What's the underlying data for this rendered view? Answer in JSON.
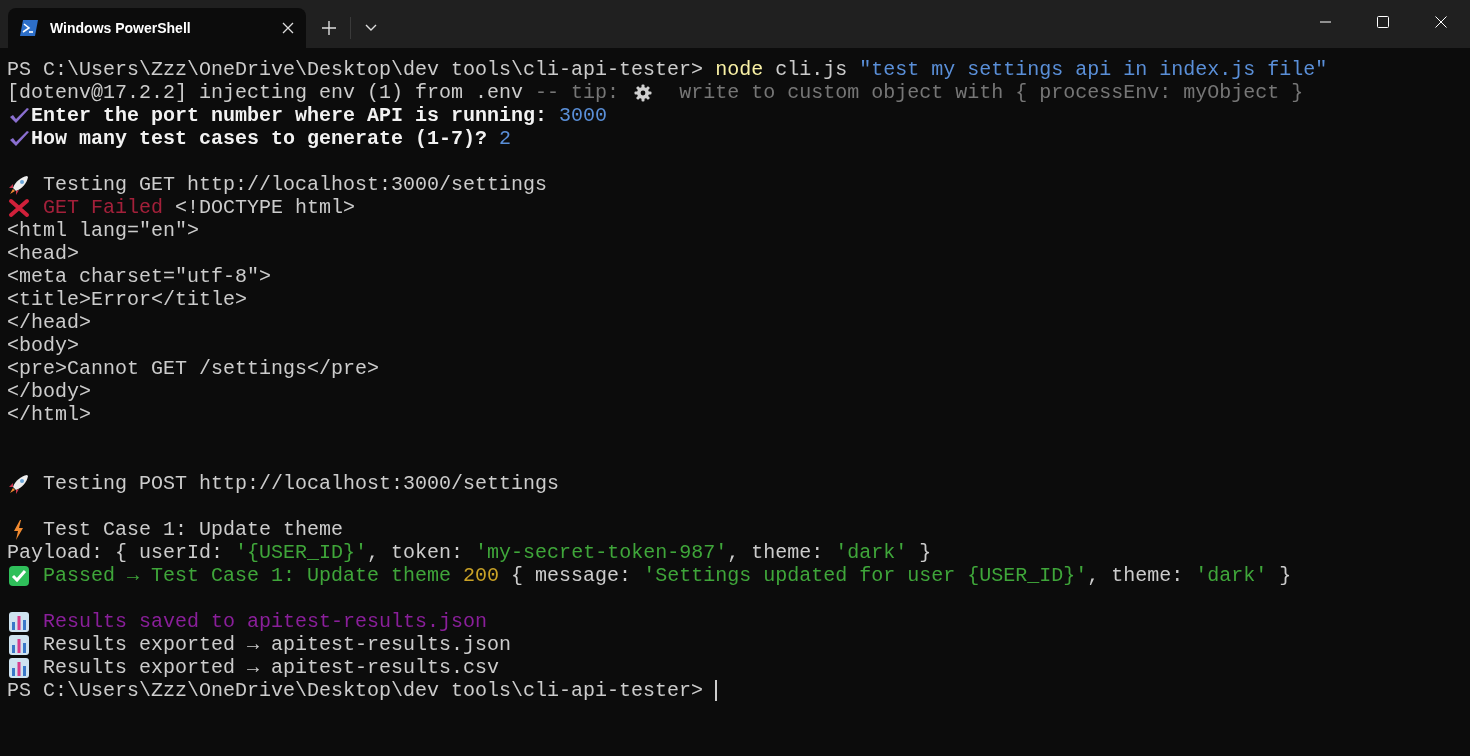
{
  "window": {
    "tab_title": "Windows PowerShell"
  },
  "terminal": {
    "lines": [
      {
        "kind": "text",
        "segments": [
          {
            "kind": "plain",
            "text": "PS C:\\Users\\Zzz\\OneDrive\\Desktop\\dev tools\\cli-api-tester> "
          },
          {
            "kind": "command",
            "text": "node"
          },
          {
            "kind": "plain",
            "text": " cli.js "
          },
          {
            "kind": "string",
            "text": "\"test my settings api in index.js file\""
          }
        ]
      },
      {
        "kind": "text",
        "segments": [
          {
            "kind": "plain",
            "text": "[dotenv@17.2.2] injecting env (1) from .env"
          },
          {
            "kind": "hint",
            "text": " -- tip: "
          },
          {
            "kind": "gear"
          },
          {
            "kind": "hint",
            "text": "  write to custom object with { processEnv: myObject }"
          }
        ]
      },
      {
        "kind": "text",
        "segments": [
          {
            "kind": "tick"
          },
          {
            "kind": "question",
            "text": "Enter the port number where API is running: "
          },
          {
            "kind": "answer",
            "text": "3000"
          }
        ]
      },
      {
        "kind": "text",
        "segments": [
          {
            "kind": "tick"
          },
          {
            "kind": "question",
            "text": "How many test cases to generate (1-7)? "
          },
          {
            "kind": "answer",
            "text": "2"
          }
        ]
      },
      {
        "kind": "blank"
      },
      {
        "kind": "text",
        "segments": [
          {
            "kind": "rocket"
          },
          {
            "kind": "plain",
            "text": " Testing GET http://localhost:3000/settings"
          }
        ]
      },
      {
        "kind": "text",
        "segments": [
          {
            "kind": "cross"
          },
          {
            "kind": "error",
            "text": " GET Failed"
          },
          {
            "kind": "plain",
            "text": " <!DOCTYPE html>"
          }
        ]
      },
      {
        "kind": "text",
        "segments": [
          {
            "kind": "plain",
            "text": "<html lang=\"en\">"
          }
        ]
      },
      {
        "kind": "text",
        "segments": [
          {
            "kind": "plain",
            "text": "<head>"
          }
        ]
      },
      {
        "kind": "text",
        "segments": [
          {
            "kind": "plain",
            "text": "<meta charset=\"utf-8\">"
          }
        ]
      },
      {
        "kind": "text",
        "segments": [
          {
            "kind": "plain",
            "text": "<title>Error</title>"
          }
        ]
      },
      {
        "kind": "text",
        "segments": [
          {
            "kind": "plain",
            "text": "</head>"
          }
        ]
      },
      {
        "kind": "text",
        "segments": [
          {
            "kind": "plain",
            "text": "<body>"
          }
        ]
      },
      {
        "kind": "text",
        "segments": [
          {
            "kind": "plain",
            "text": "<pre>Cannot GET /settings</pre>"
          }
        ]
      },
      {
        "kind": "text",
        "segments": [
          {
            "kind": "plain",
            "text": "</body>"
          }
        ]
      },
      {
        "kind": "text",
        "segments": [
          {
            "kind": "plain",
            "text": "</html>"
          }
        ]
      },
      {
        "kind": "blank"
      },
      {
        "kind": "blank"
      },
      {
        "kind": "text",
        "segments": [
          {
            "kind": "rocket"
          },
          {
            "kind": "plain",
            "text": " Testing POST http://localhost:3000/settings"
          }
        ]
      },
      {
        "kind": "blank"
      },
      {
        "kind": "text",
        "segments": [
          {
            "kind": "bolt"
          },
          {
            "kind": "plain",
            "text": " Test Case 1: Update theme"
          }
        ]
      },
      {
        "kind": "text",
        "segments": [
          {
            "kind": "plain",
            "text": "Payload: { userId: "
          },
          {
            "kind": "value",
            "text": "'{USER_ID}'"
          },
          {
            "kind": "plain",
            "text": ", token: "
          },
          {
            "kind": "value",
            "text": "'my-secret-token-987'"
          },
          {
            "kind": "plain",
            "text": ", theme: "
          },
          {
            "kind": "value",
            "text": "'dark'"
          },
          {
            "kind": "plain",
            "text": " }"
          }
        ]
      },
      {
        "kind": "text",
        "segments": [
          {
            "kind": "checkbox"
          },
          {
            "kind": "value",
            "text": " Passed → Test Case 1: Update theme "
          },
          {
            "kind": "status",
            "text": "200"
          },
          {
            "kind": "plain",
            "text": " { message: "
          },
          {
            "kind": "value",
            "text": "'Settings updated for user {USER_ID}'"
          },
          {
            "kind": "plain",
            "text": ", theme: "
          },
          {
            "kind": "value",
            "text": "'dark'"
          },
          {
            "kind": "plain",
            "text": " }"
          }
        ]
      },
      {
        "kind": "blank"
      },
      {
        "kind": "text",
        "segments": [
          {
            "kind": "chart"
          },
          {
            "kind": "saved",
            "text": " Results saved to apitest-results.json"
          }
        ]
      },
      {
        "kind": "text",
        "segments": [
          {
            "kind": "chart"
          },
          {
            "kind": "plain",
            "text": " Results exported → apitest-results.json"
          }
        ]
      },
      {
        "kind": "text",
        "segments": [
          {
            "kind": "chart"
          },
          {
            "kind": "plain",
            "text": " Results exported → apitest-results.csv"
          }
        ]
      },
      {
        "kind": "prompt",
        "cursor": true,
        "segments": [
          {
            "kind": "plain",
            "text": "PS C:\\Users\\Zzz\\OneDrive\\Desktop\\dev tools\\cli-api-tester> "
          }
        ]
      }
    ]
  }
}
